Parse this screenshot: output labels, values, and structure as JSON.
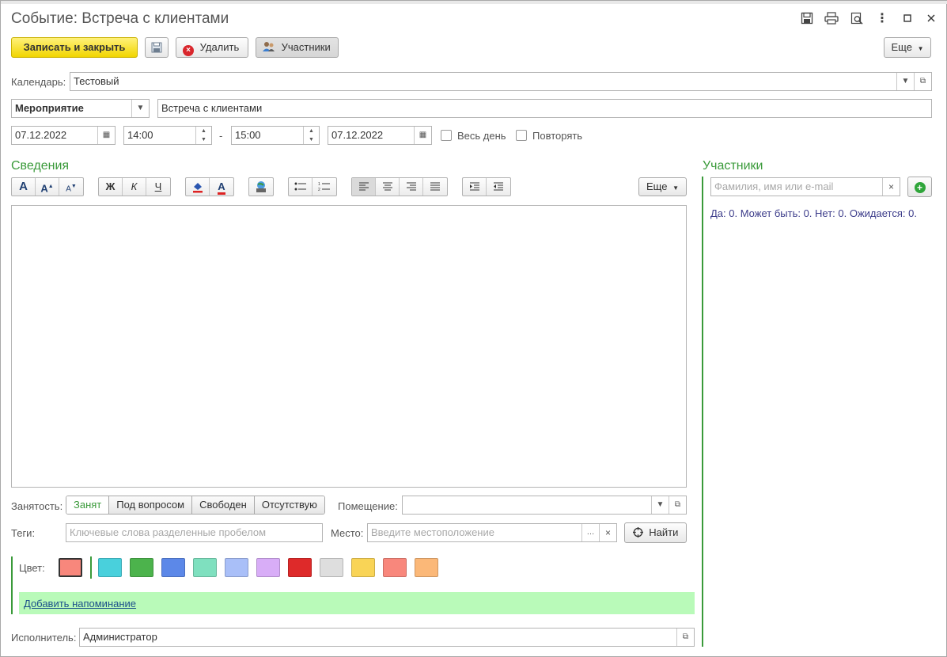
{
  "window": {
    "title": "Событие: Встреча с клиентами"
  },
  "toolbar": {
    "save_close": "Записать и закрыть",
    "delete": "Удалить",
    "participants": "Участники",
    "more": "Еще"
  },
  "calendar": {
    "label": "Календарь:",
    "value": "Тестовый"
  },
  "event": {
    "type": "Мероприятие",
    "subject": "Встреча с клиентами",
    "start_date": "07.12.2022",
    "start_time": "14:00",
    "dash": "-",
    "end_time": "15:00",
    "end_date": "07.12.2022",
    "all_day_label": "Весь день",
    "repeat_label": "Повторять"
  },
  "details": {
    "title": "Сведения",
    "more": "Еще",
    "bold": "Ж",
    "italic": "К",
    "underline": "Ч"
  },
  "busy": {
    "label": "Занятость:",
    "options": [
      "Занят",
      "Под вопросом",
      "Свободен",
      "Отсутствую"
    ],
    "selected": "Занят"
  },
  "room": {
    "label": "Помещение:",
    "value": ""
  },
  "tags": {
    "label": "Теги:",
    "placeholder": "Ключевые слова разделенные пробелом"
  },
  "place": {
    "label": "Место:",
    "placeholder": "Введите местоположение",
    "find": "Найти"
  },
  "color": {
    "label": "Цвет:",
    "selected": "#f8877c",
    "palette": [
      "#49d0dc",
      "#4cb34c",
      "#5c88e8",
      "#7fe0bf",
      "#a9bff8",
      "#d8adf7",
      "#de2a2a",
      "#dedede",
      "#f9d456",
      "#f8877c",
      "#fbb878"
    ]
  },
  "reminder": {
    "link": "Добавить напоминание"
  },
  "executor": {
    "label": "Исполнитель:",
    "value": "Администратор"
  },
  "participants_panel": {
    "title": "Участники",
    "search_placeholder": "Фамилия, имя или e-mail",
    "summary": "Да: 0. Может быть: 0. Нет: 0. Ожидается: 0."
  },
  "colors": {
    "accent_green": "#3a9a3a",
    "primary_button": "#f5d800",
    "reminder_bg": "#b9fab9"
  }
}
